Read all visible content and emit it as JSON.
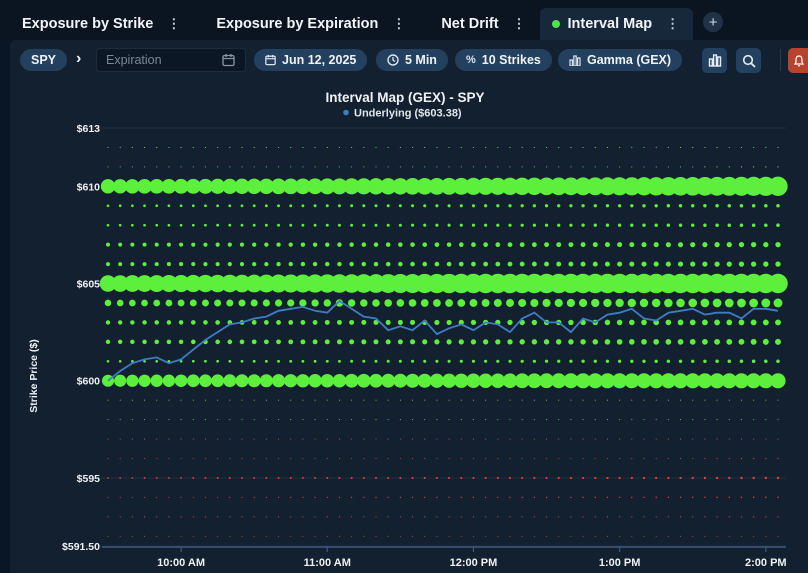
{
  "tabs": [
    {
      "label": "Exposure by Strike",
      "active": false
    },
    {
      "label": "Exposure by Expiration",
      "active": false
    },
    {
      "label": "Net Drift",
      "active": false
    },
    {
      "label": "Interval Map",
      "active": true
    }
  ],
  "tab_add_label": "+",
  "tab_menu_glyph": "⋮",
  "toolbar": {
    "symbol": "SPY",
    "chevron": "›",
    "expiration_placeholder": "Expiration",
    "date": "Jun 12, 2025",
    "interval": "5 Min",
    "strikes": "10 Strikes",
    "metric": "Gamma (GEX)"
  },
  "icons": {
    "calendar": "calendar-icon",
    "clock": "clock-icon",
    "percent": "percent-icon",
    "bar_chart": "bar-chart-icon",
    "search": "search-icon"
  },
  "colors": {
    "positive": "#5cf03c",
    "negative": "#e8432c",
    "underlying_line": "#3f7cc4",
    "accent": "#23405f"
  },
  "chart_data": {
    "type": "scatter",
    "title": "Interval Map (GEX) - SPY",
    "legend": {
      "label": "Underlying ($603.38)",
      "placement": "top-center"
    },
    "ylabel": "Strike Price ($)",
    "xlabel": "",
    "ylim": [
      591.5,
      613
    ],
    "y_ticks": [
      613,
      610,
      605,
      600,
      595,
      591.5
    ],
    "y_tick_labels": [
      "$613",
      "$610",
      "$605",
      "$600",
      "$595",
      "$591.50"
    ],
    "x_ticks": [
      "9:30",
      "10:00",
      "11:00",
      "12:00",
      "13:00",
      "14:00"
    ],
    "x_tick_labels": [
      "10:00 AM",
      "11:00 AM",
      "12:00 PM",
      "1:00 PM",
      "2:00 PM"
    ],
    "x_tick_times": [
      "10:00",
      "11:00",
      "12:00",
      "13:00",
      "14:00"
    ],
    "x_start": "09:30",
    "x_end": "14:05",
    "interval_minutes": 5,
    "strikes": [
      592,
      593,
      594,
      595,
      596,
      597,
      598,
      599,
      600,
      601,
      602,
      603,
      604,
      605,
      606,
      607,
      608,
      609,
      610,
      611,
      612
    ],
    "strike_relative_gex": {
      "592": -0.03,
      "593": -0.04,
      "594": -0.05,
      "595": -0.08,
      "596": -0.04,
      "597": -0.03,
      "598": 0.02,
      "599": 0.03,
      "600": 0.55,
      "601": 0.12,
      "602": 0.2,
      "603": 0.2,
      "604": 0.3,
      "605": 0.75,
      "606": 0.18,
      "607": 0.18,
      "608": 0.12,
      "609": 0.12,
      "610": 0.65,
      "611": 0.04,
      "612": 0.03
    },
    "gex_growth_over_day": 0.35,
    "series": [
      {
        "name": "Underlying ($603.38)",
        "x": [
          "09:30",
          "09:35",
          "09:40",
          "09:45",
          "09:50",
          "09:55",
          "10:00",
          "10:05",
          "10:10",
          "10:15",
          "10:20",
          "10:25",
          "10:30",
          "10:35",
          "10:40",
          "10:45",
          "10:50",
          "10:55",
          "11:00",
          "11:05",
          "11:10",
          "11:15",
          "11:20",
          "11:25",
          "11:30",
          "11:35",
          "11:40",
          "11:45",
          "11:50",
          "11:55",
          "12:00",
          "12:05",
          "12:10",
          "12:15",
          "12:20",
          "12:25",
          "12:30",
          "12:35",
          "12:40",
          "12:45",
          "12:50",
          "12:55",
          "13:00",
          "13:05",
          "13:10",
          "13:15",
          "13:20",
          "13:25",
          "13:30",
          "13:35",
          "13:40",
          "13:45",
          "13:50",
          "13:55",
          "14:00",
          "14:05"
        ],
        "y": [
          600.0,
          600.5,
          600.9,
          601.1,
          601.2,
          600.9,
          601.1,
          601.6,
          602.1,
          602.5,
          602.9,
          603.0,
          603.2,
          603.3,
          603.6,
          603.7,
          603.8,
          603.6,
          603.5,
          604.1,
          603.7,
          603.3,
          603.2,
          602.6,
          602.8,
          602.6,
          603.1,
          602.4,
          602.7,
          602.9,
          602.6,
          603.0,
          602.9,
          602.5,
          603.2,
          603.5,
          603.0,
          603.0,
          602.5,
          603.2,
          603.0,
          603.4,
          603.5,
          603.7,
          603.2,
          603.1,
          603.5,
          603.6,
          603.7,
          603.4,
          603.5,
          603.5,
          603.2,
          603.7,
          603.7,
          603.6
        ]
      }
    ]
  }
}
